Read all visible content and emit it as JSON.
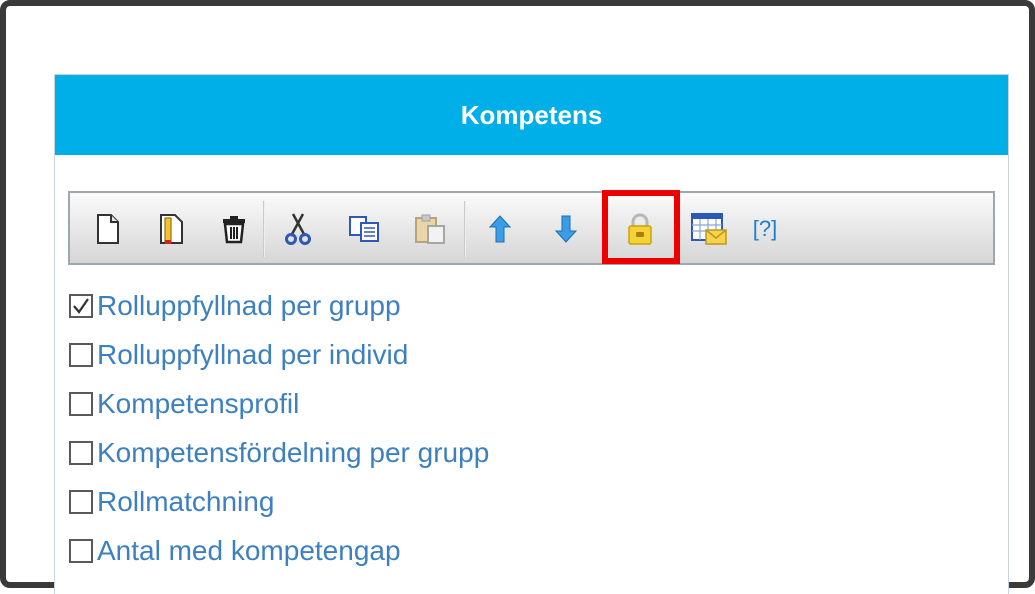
{
  "panel": {
    "title": "Kompetens"
  },
  "toolbar": {
    "buttons": [
      {
        "icon": "new-document-icon"
      },
      {
        "icon": "edit-document-icon"
      },
      {
        "icon": "trash-icon"
      },
      {
        "icon": "cut-icon"
      },
      {
        "icon": "copy-icon"
      },
      {
        "icon": "paste-icon"
      },
      {
        "icon": "arrow-up-icon"
      },
      {
        "icon": "arrow-down-icon"
      },
      {
        "icon": "lock-icon",
        "highlighted": true
      },
      {
        "icon": "calendar-mail-icon"
      }
    ],
    "help_label": "[?]",
    "colors": {
      "highlight": "#ef0000",
      "header": "#00aee8",
      "link": "#3d80c0"
    }
  },
  "reports": [
    {
      "label": "Rolluppfyllnad per grupp",
      "checked": true
    },
    {
      "label": "Rolluppfyllnad per individ",
      "checked": false
    },
    {
      "label": "Kompetensprofil",
      "checked": false
    },
    {
      "label": "Kompetensfördelning per grupp",
      "checked": false
    },
    {
      "label": "Rollmatchning",
      "checked": false
    },
    {
      "label": "Antal med kompetengap",
      "checked": false
    }
  ]
}
